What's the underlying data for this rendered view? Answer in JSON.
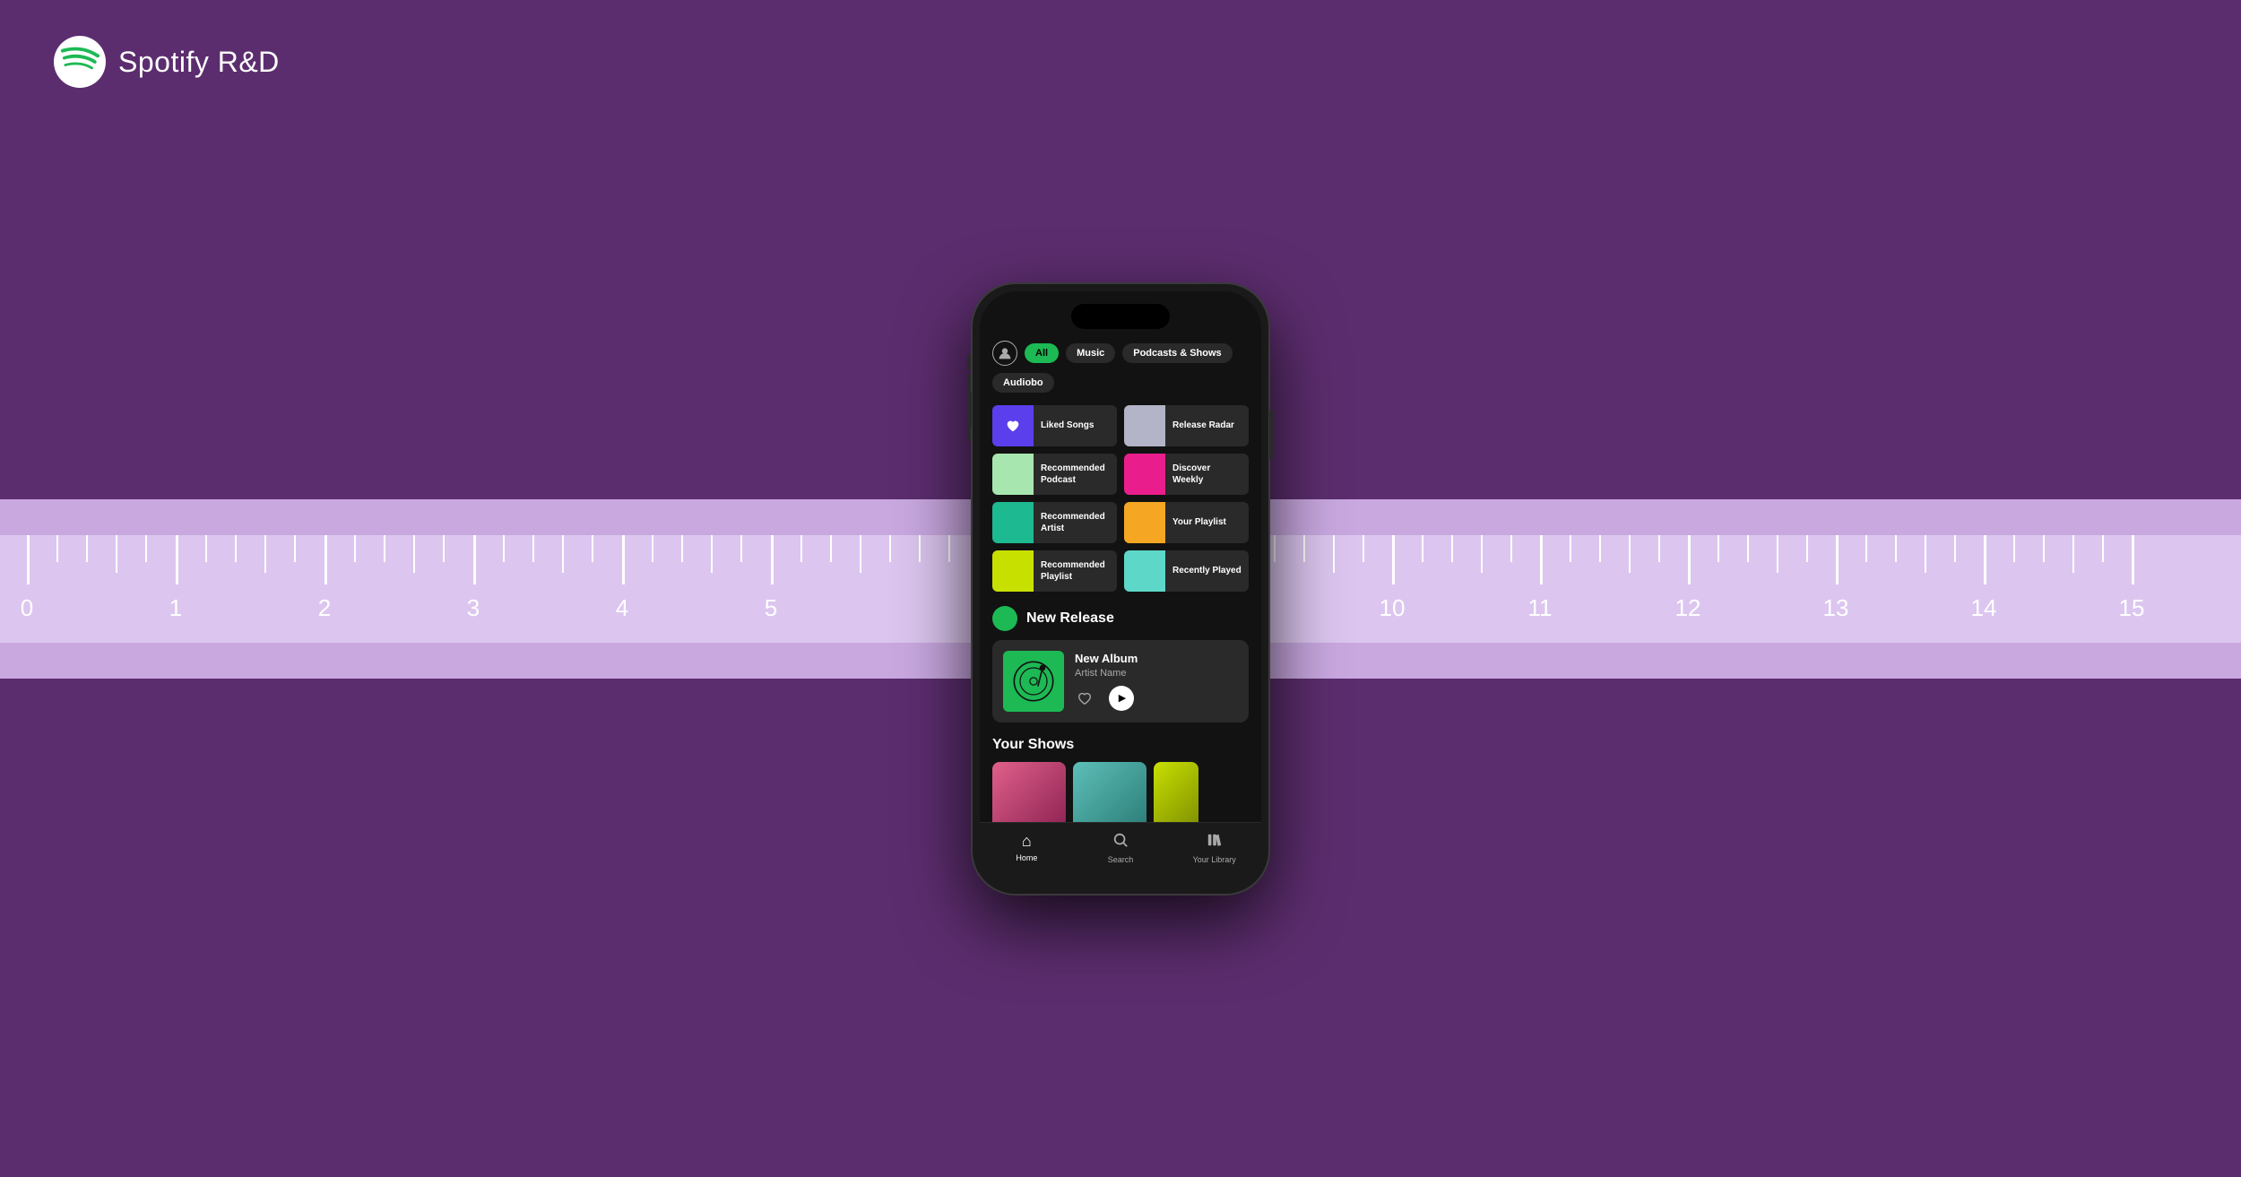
{
  "brand": {
    "name": "Spotify",
    "suffix": " R&D"
  },
  "phone": {
    "filters": [
      {
        "label": "All",
        "active": true
      },
      {
        "label": "Music",
        "active": false
      },
      {
        "label": "Podcasts & Shows",
        "active": false
      },
      {
        "label": "Audiobo",
        "active": false
      }
    ],
    "grid_items": [
      {
        "label": "Liked Songs",
        "color": "#5b3fec"
      },
      {
        "label": "Release Radar",
        "color": "#b4b4c8"
      },
      {
        "label": "Recommended Podcast",
        "color": "#a8e6b0"
      },
      {
        "label": "Discover Weekly",
        "color": "#e91e8c"
      },
      {
        "label": "Recommended Artist",
        "color": "#1db990"
      },
      {
        "label": "Your Playlist",
        "color": "#f5a623"
      },
      {
        "label": "Recommended Playlist",
        "color": "#c8e000"
      },
      {
        "label": "Recently Played",
        "color": "#5dd8c8"
      }
    ],
    "new_release": {
      "section_title": "New Release",
      "album_title": "New Album",
      "album_artist": "Artist Name"
    },
    "your_shows": {
      "title": "Your Shows",
      "shows": [
        {
          "color": "#c8426a"
        },
        {
          "color": "#5dbfb8"
        },
        {
          "color": "#b8d400"
        }
      ]
    },
    "bottom_nav": [
      {
        "icon": "⌂",
        "label": "Home",
        "active": true
      },
      {
        "icon": "⌕",
        "label": "Search",
        "active": false
      },
      {
        "icon": "▥",
        "label": "Your Library",
        "active": false
      }
    ]
  },
  "ruler": {
    "numbers": [
      "0",
      "1",
      "2",
      "3",
      "4",
      "5",
      "",
      "",
      "",
      "",
      "10",
      "11",
      "12",
      "13",
      "14",
      "15"
    ]
  }
}
